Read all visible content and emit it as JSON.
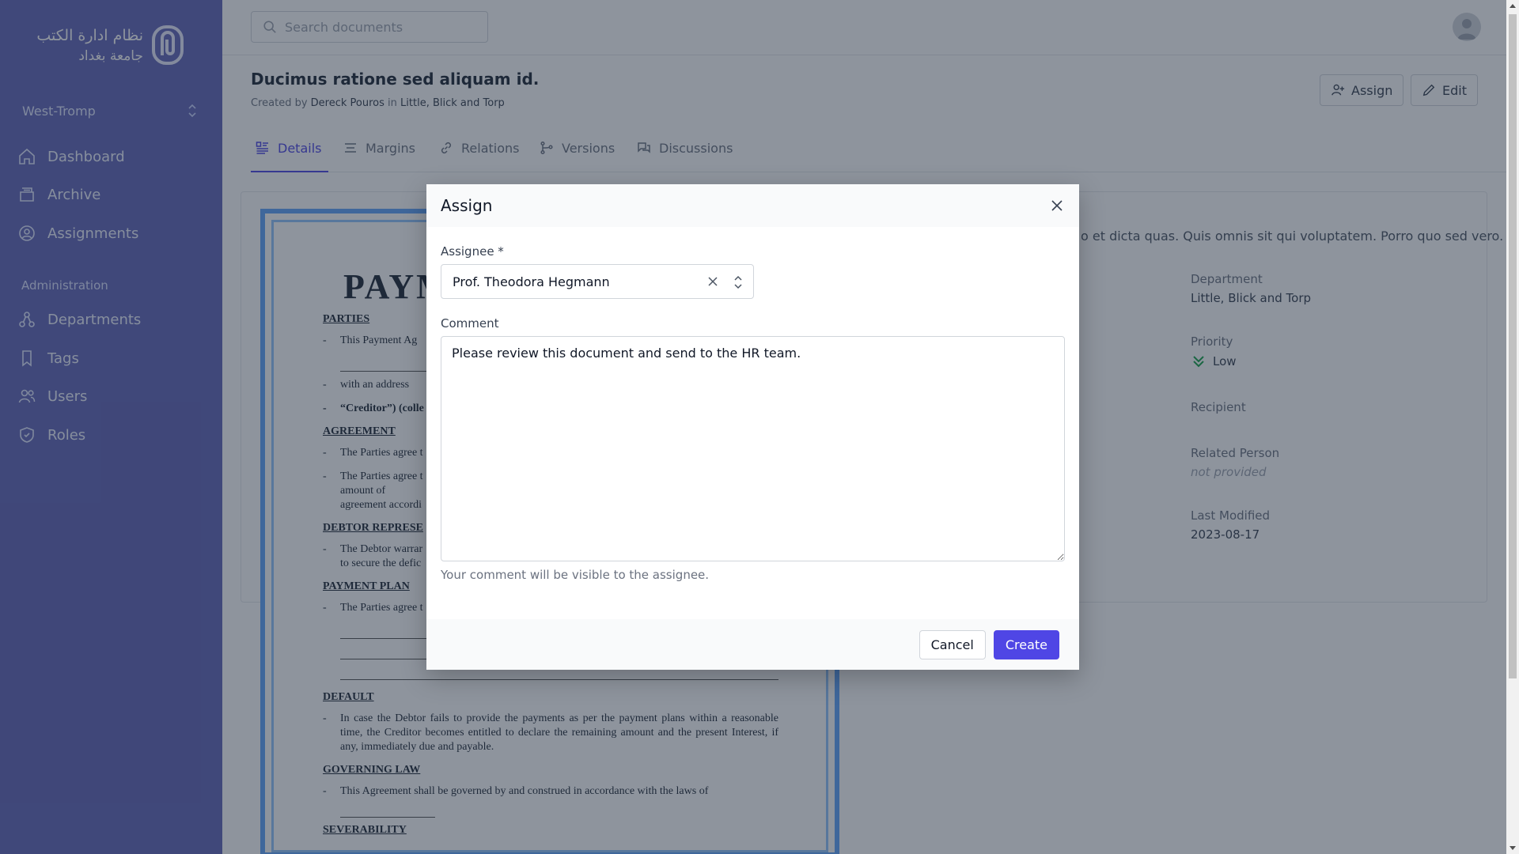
{
  "app": {
    "logo_text_line1": "نظام ادارة الكتب",
    "logo_text_line2": "جامعة بغداد",
    "team": "West-Tromp"
  },
  "sidebar": {
    "items": [
      {
        "label": "Dashboard",
        "icon": "home-icon"
      },
      {
        "label": "Archive",
        "icon": "archive-icon"
      },
      {
        "label": "Assignments",
        "icon": "user-circle-icon"
      }
    ],
    "section_label": "Administration",
    "admin_items": [
      {
        "label": "Departments",
        "icon": "departments-icon"
      },
      {
        "label": "Tags",
        "icon": "tag-icon"
      },
      {
        "label": "Users",
        "icon": "users-icon"
      },
      {
        "label": "Roles",
        "icon": "shield-icon"
      }
    ]
  },
  "header": {
    "search_placeholder": "Search documents"
  },
  "document": {
    "title": "Ducimus ratione sed aliquam id.",
    "meta_created_by": "Created by",
    "meta_author": "Dereck Pouros",
    "meta_in": "in",
    "meta_department": "Little, Blick and Torp",
    "assign_label": "Assign",
    "edit_label": "Edit",
    "tabs": [
      {
        "label": "Details",
        "active": true
      },
      {
        "label": "Margins",
        "active": false
      },
      {
        "label": "Relations",
        "active": false
      },
      {
        "label": "Versions",
        "active": false
      },
      {
        "label": "Discussions",
        "active": false
      }
    ],
    "description_fragment": "o et dicta quas. Quis omnis sit qui voluptatem. Porro quo sed vero.",
    "fields": {
      "department_label": "Department",
      "department_value": "Little, Blick and Torp",
      "priority_label": "Priority",
      "priority_value": "Low",
      "recipient_label": "Recipient",
      "related_label": "Related Person",
      "related_value": "not provided",
      "modified_label": "Last Modified",
      "modified_value": "2023-08-17"
    }
  },
  "preview": {
    "title": "PAYM",
    "h_parties": "PARTIES",
    "parties_l1": "This Payment Ag",
    "parties_l2": "with an address",
    "parties_l3": "“Creditor”) (colle",
    "h_agreement": "AGREEMENT",
    "agreement_l1": "The Parties agree t",
    "agreement_l2": "The Parties agree t",
    "agreement_l2b": "amount of",
    "agreement_l2c": "agreement accordi",
    "h_debtor": "DEBTOR REPRESE",
    "debtor_l1": "The Debtor warrar",
    "debtor_l1b": "to secure the defic",
    "h_plan": "PAYMENT PLAN",
    "plan_l1": "The Parties agree t",
    "h_default": "DEFAULT",
    "default_l1": "In case the Debtor fails to provide the payments as per the payment plans within a reasonable time, the Creditor becomes entitled to declare the remaining amount and the present Interest, if any, immediately due and payable.",
    "h_law": "GOVERNING LAW",
    "law_l1": "This Agreement shall be governed by and construed in accordance with the laws of",
    "h_sev": "SEVERABILITY"
  },
  "modal": {
    "title": "Assign",
    "assignee_label": "Assignee *",
    "assignee_value": "Prof. Theodora Hegmann",
    "comment_label": "Comment",
    "comment_value": "Please review this document and send to the HR team.",
    "hint": "Your comment will be visible to the assignee.",
    "cancel_label": "Cancel",
    "create_label": "Create"
  }
}
